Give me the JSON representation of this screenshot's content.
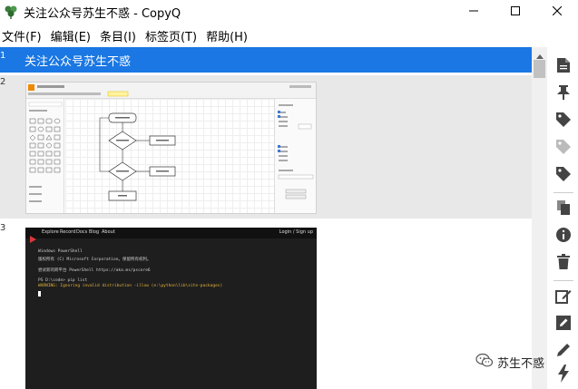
{
  "window": {
    "title": "关注公众号苏生不惑 - CopyQ",
    "app_icon": "copyq-icon",
    "controls": [
      "minimize-icon",
      "maximize-icon",
      "close-icon"
    ]
  },
  "menu": {
    "items": [
      "文件(F)",
      "编辑(E)",
      "条目(I)",
      "标签页(T)",
      "帮助(H)"
    ]
  },
  "items": [
    {
      "number": "1",
      "text": "关注公众号苏生不惑",
      "selected": true
    },
    {
      "number": "2",
      "type": "image",
      "content": "diagram-editor-screenshot"
    },
    {
      "number": "3",
      "type": "image",
      "content": "terminal-screenshot",
      "nav": [
        "Explore",
        "Record",
        "Docs",
        "Blog",
        "About"
      ],
      "nav_right": "Login / Sign up",
      "lines": [
        "Windows PowerShell",
        "版权所有 (C) Microsoft Corporation。保留所有权利。",
        "尝试新的跨平台 PowerShell https://aka.ms/pscore6",
        "PS D:\\code> pip list",
        "WARNING: Ignoring invalid distribution -illow (e:\\python\\lib\\site-packages)"
      ]
    }
  ],
  "toolbar": {
    "icons": [
      "document-icon",
      "pin-icon",
      "tag-icon",
      "tag-disabled-icon",
      "tag-icon",
      "copy-icon",
      "info-icon",
      "trash-icon",
      "edit-external-icon",
      "edit-icon",
      "pencil-icon",
      "lightning-icon"
    ]
  },
  "watermark": {
    "text": "苏生不惑",
    "icon": "wechat-icon"
  },
  "colors": {
    "selection": "#1a77e3",
    "row_alt": "#e8e8e8",
    "icon": "#444444"
  }
}
